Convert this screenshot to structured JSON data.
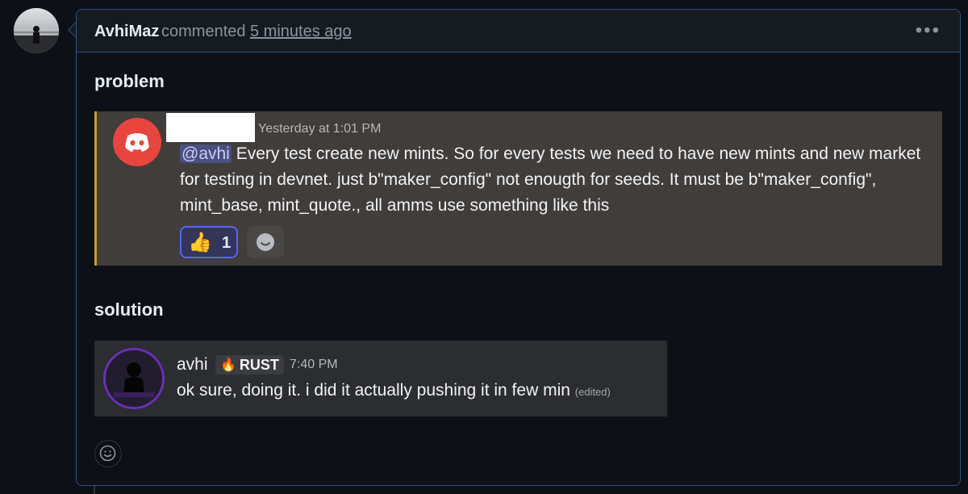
{
  "comment": {
    "author": "AvhiMaz",
    "action": "commented",
    "time": "5 minutes ago",
    "more_icon": "more-horizontal-icon"
  },
  "sections": {
    "problem_title": "problem",
    "solution_title": "solution"
  },
  "discord_quote": {
    "timestamp": "Yesterday at 1:01 PM",
    "mention": "@avhi",
    "message": "Every test create new mints. So for every tests we need to have new mints and new market for testing in devnet. just b\"maker_config\" not enougth for seeds. It must be b\"maker_config\", mint_base, mint_quote., all amms use something like this",
    "reaction_emoji": "👍",
    "reaction_count": "1",
    "accent_color": "#c59a34"
  },
  "discord_reply": {
    "username": "avhi",
    "badge_icon": "🔥",
    "badge_label": "RUST",
    "timestamp": "7:40 PM",
    "message": "ok sure, doing it. i did it actually pushing it in few min",
    "edited_label": "(edited)"
  },
  "colors": {
    "comment_border": "#2f4f83",
    "discord_brand": "#e8453f",
    "mention_bg": "#4a4f7d"
  }
}
